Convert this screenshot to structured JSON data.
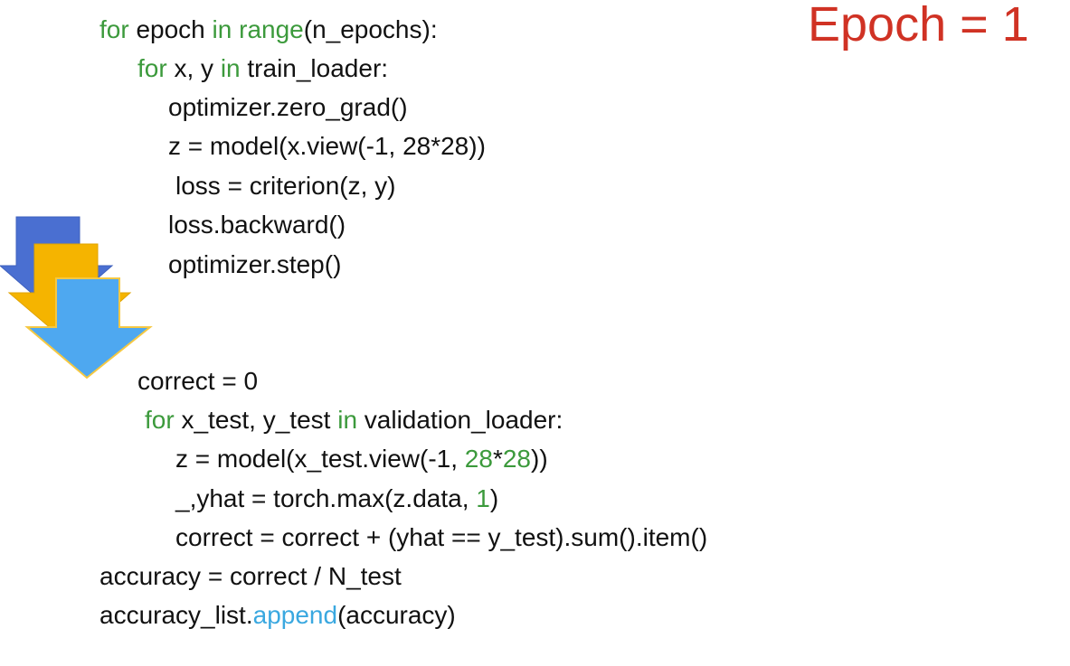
{
  "epoch_label": "Epoch = 1",
  "colors": {
    "keyword": "#3c9a3c",
    "number": "#3c9a3c",
    "builtin_method": "#3aa8e0",
    "epoch_label": "#d03224",
    "text": "#111111",
    "arrow_back": "#4a6fd1",
    "arrow_middle": "#f5b400",
    "arrow_front": "#4ea8f0"
  },
  "code_lines": [
    {
      "id": "line-1",
      "tokens": [
        {
          "text": "for",
          "type": "keyword"
        },
        {
          "text": " epoch ",
          "type": "text"
        },
        {
          "text": "in",
          "type": "keyword"
        },
        {
          "text": " ",
          "type": "text"
        },
        {
          "text": "range",
          "type": "keyword"
        },
        {
          "text": "(n_epochs):",
          "type": "text"
        }
      ]
    },
    {
      "id": "line-2",
      "tokens": [
        {
          "text": "for",
          "type": "keyword"
        },
        {
          "text": " x, y ",
          "type": "text"
        },
        {
          "text": "in",
          "type": "keyword"
        },
        {
          "text": " train_loader:",
          "type": "text"
        }
      ]
    },
    {
      "id": "line-3",
      "tokens": [
        {
          "text": "optimizer.zero_grad()",
          "type": "text"
        }
      ]
    },
    {
      "id": "line-4",
      "tokens": [
        {
          "text": "z = model(x.view(-1, 28*28))",
          "type": "text"
        }
      ]
    },
    {
      "id": "line-5",
      "tokens": [
        {
          "text": "loss = criterion(z, y)",
          "type": "text"
        }
      ]
    },
    {
      "id": "line-6",
      "tokens": [
        {
          "text": "loss.backward()",
          "type": "text"
        }
      ]
    },
    {
      "id": "line-7",
      "tokens": [
        {
          "text": "optimizer.step()",
          "type": "text"
        }
      ]
    },
    {
      "id": "line-8",
      "tokens": [
        {
          "text": "correct = 0",
          "type": "text"
        }
      ]
    },
    {
      "id": "line-9",
      "tokens": [
        {
          "text": "for",
          "type": "keyword"
        },
        {
          "text": " x_test, y_test ",
          "type": "text"
        },
        {
          "text": "in",
          "type": "keyword"
        },
        {
          "text": " validation_loader:",
          "type": "text"
        }
      ]
    },
    {
      "id": "line-10",
      "tokens": [
        {
          "text": "z = model(x_test.view(-1, ",
          "type": "text"
        },
        {
          "text": "28",
          "type": "number"
        },
        {
          "text": "*",
          "type": "text"
        },
        {
          "text": "28",
          "type": "number"
        },
        {
          "text": "))",
          "type": "text"
        }
      ]
    },
    {
      "id": "line-11",
      "tokens": [
        {
          "text": "_,yhat = torch.max(z.data, ",
          "type": "text"
        },
        {
          "text": "1",
          "type": "number"
        },
        {
          "text": ")",
          "type": "text"
        }
      ]
    },
    {
      "id": "line-12",
      "tokens": [
        {
          "text": "correct = correct + (yhat == y_test).sum().item()",
          "type": "text"
        }
      ]
    },
    {
      "id": "line-13",
      "tokens": [
        {
          "text": "accuracy = correct / N_test",
          "type": "text"
        }
      ]
    },
    {
      "id": "line-14",
      "tokens": [
        {
          "text": "accuracy_list.",
          "type": "text"
        },
        {
          "text": "append",
          "type": "builtin_method"
        },
        {
          "text": "(accuracy)",
          "type": "text"
        }
      ]
    }
  ]
}
